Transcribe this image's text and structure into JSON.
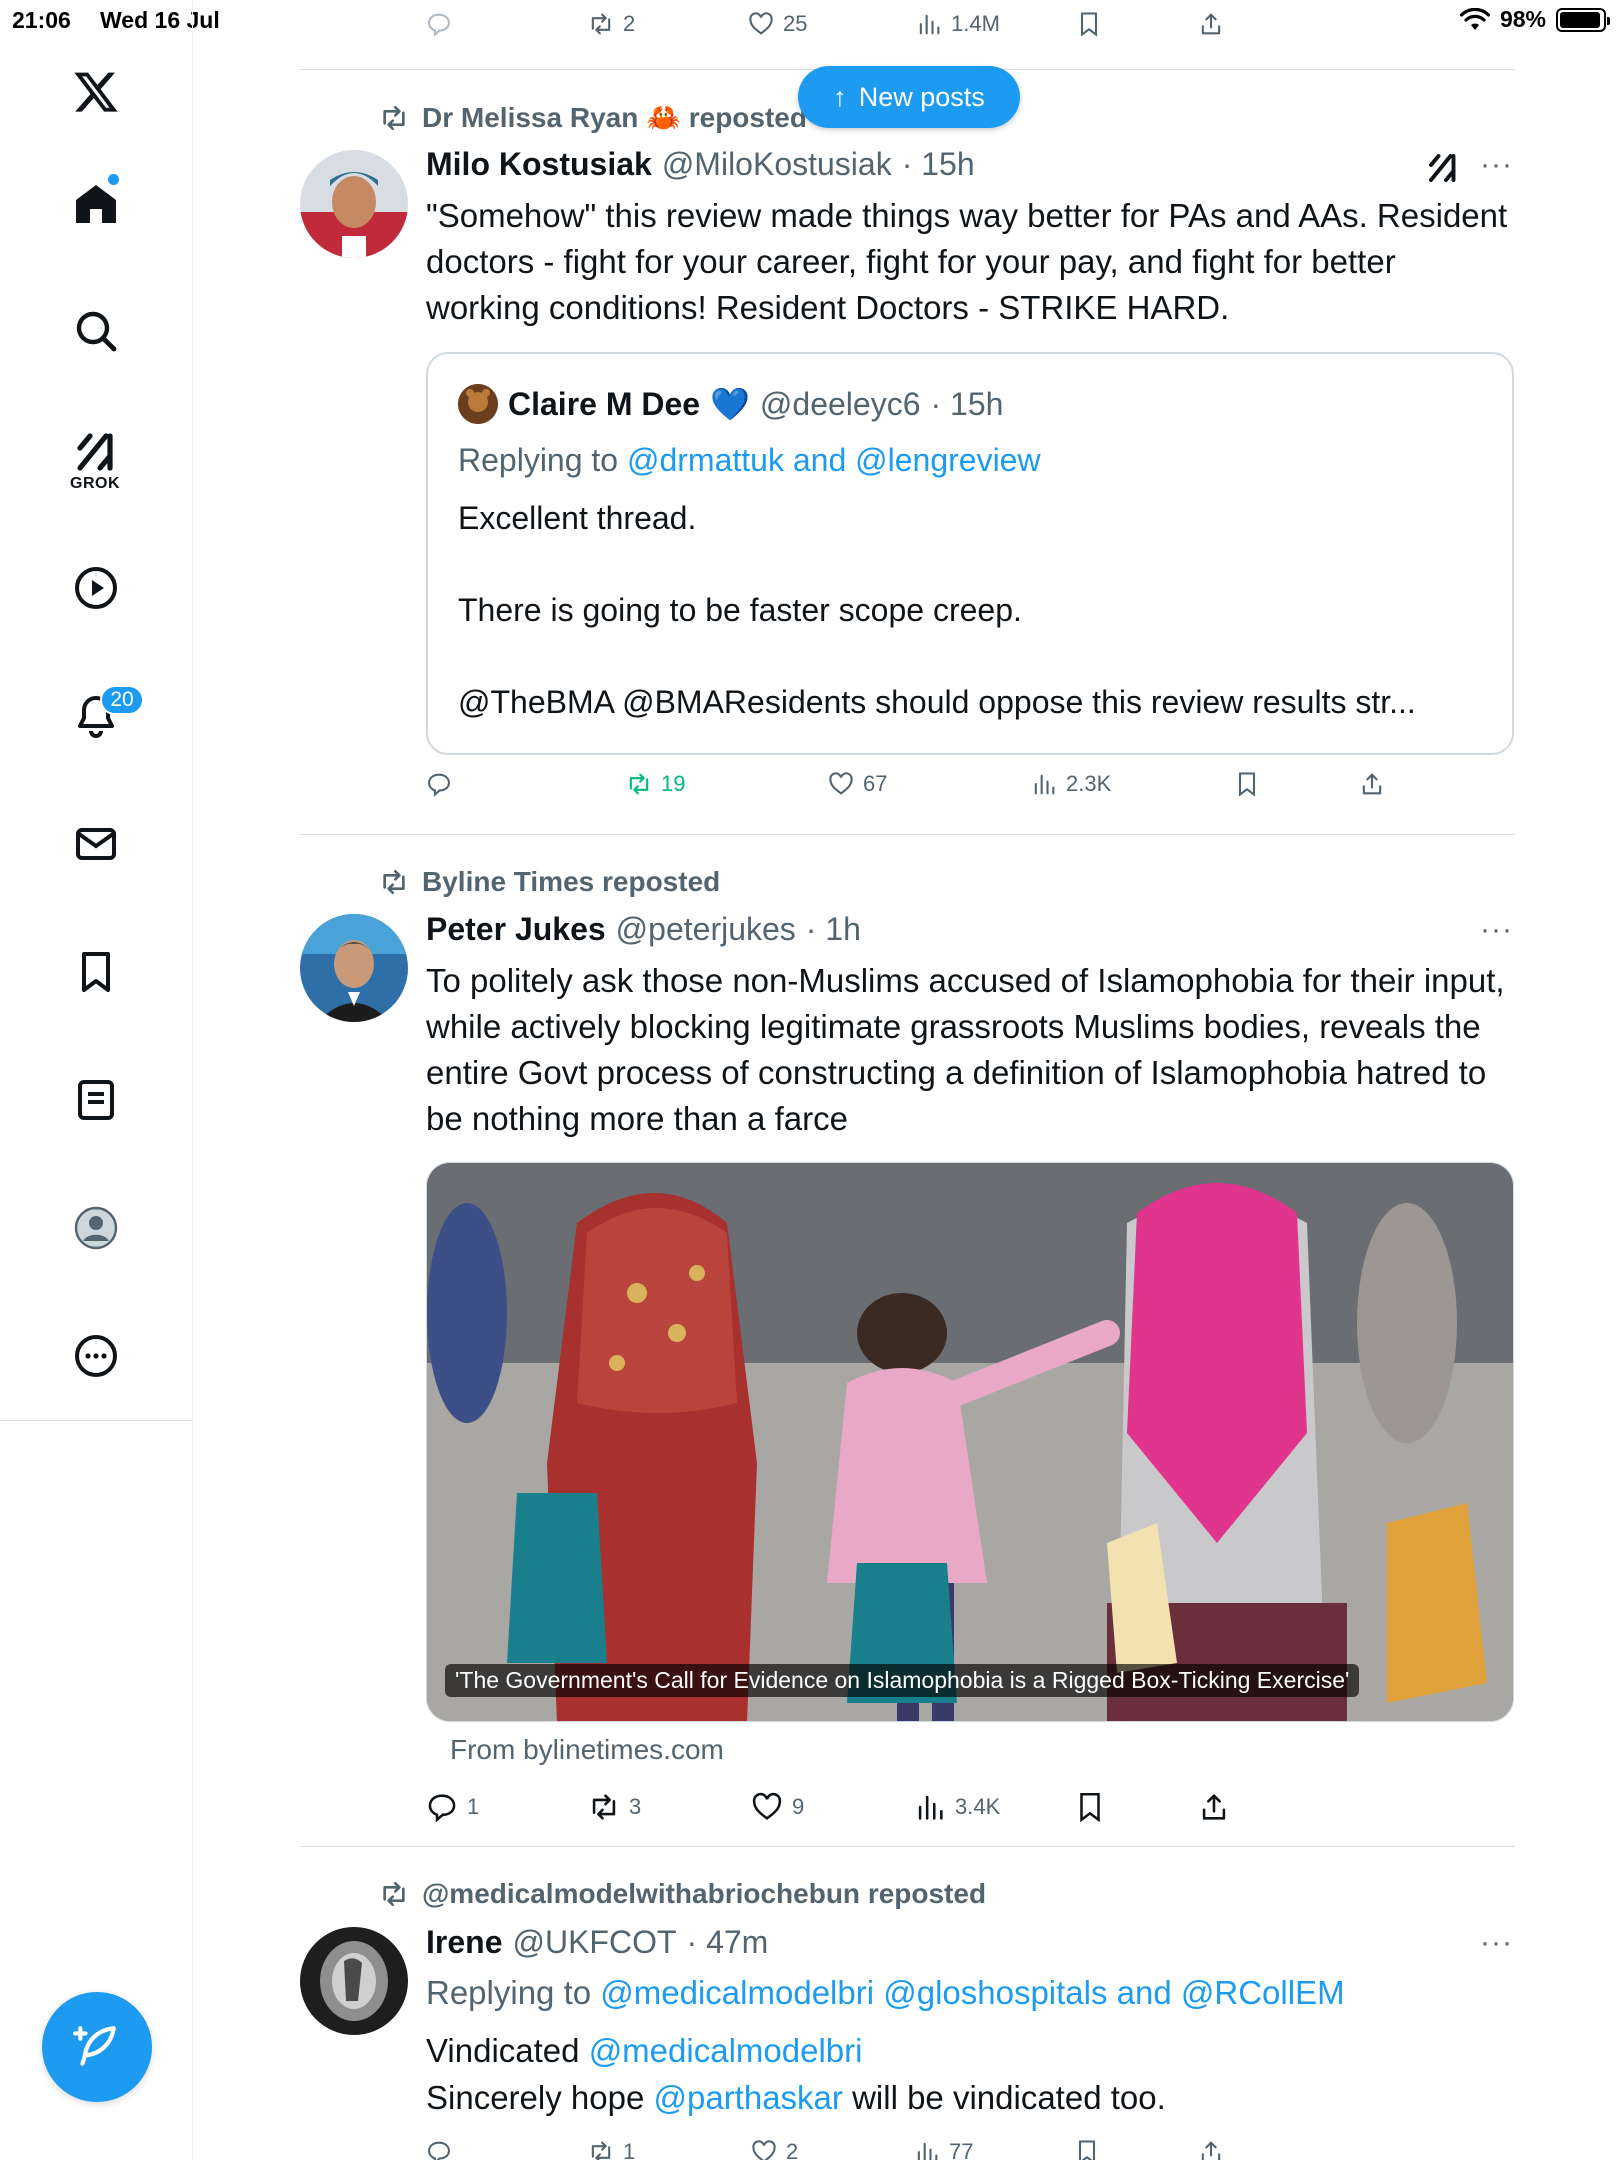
{
  "status_bar": {
    "time": "21:06",
    "date": "Wed 16 Jul",
    "battery": "98%"
  },
  "sidebar": {
    "grok_label": "GROK",
    "notifications_count": "20"
  },
  "new_posts": {
    "label": "New posts"
  },
  "top_actions": {
    "retweets": "2",
    "likes": "25",
    "views": "1.4M"
  },
  "tweets": [
    {
      "reposted_by": "Dr Melissa Ryan 🦀 reposted",
      "name": "Milo Kostusiak",
      "handle": "@MiloKostusiak",
      "time": "· 15h",
      "text": "\"Somehow\" this review made things way better for PAs and AAs. Resident doctors - fight for your career, fight for your pay, and fight for better working conditions! Resident Doctors - STRIKE HARD.",
      "quote": {
        "name": "Claire M Dee",
        "heart": "💙",
        "handle": "@deeleyc6",
        "time": "· 15h",
        "replying_label": "Replying to",
        "replying_to": "@drmattuk and @lengreview",
        "line1": "Excellent thread.",
        "line2": "There is going to be faster scope creep.",
        "line3": "@TheBMA @BMAResidents should oppose this review results str..."
      },
      "actions": {
        "replies": "",
        "retweets": "19",
        "likes": "67",
        "views": "2.3K"
      }
    },
    {
      "reposted_by": "Byline Times reposted",
      "name": "Peter Jukes",
      "handle": "@peterjukes",
      "time": "· 1h",
      "text": "To politely ask those non-Muslims accused of Islamophobia for their input, while actively blocking legitimate grassroots Muslims bodies, reveals the entire Govt process of constructing a definition of Islamophobia hatred to be nothing more than a farce",
      "media_caption": "'The Government's Call for Evidence on Islamophobia is a Rigged Box-Ticking Exercise'",
      "link_source": "From bylinetimes.com",
      "actions": {
        "replies": "1",
        "retweets": "3",
        "likes": "9",
        "views": "3.4K"
      }
    },
    {
      "reposted_by": "@medicalmodelwithabriochebun reposted",
      "name": "Irene",
      "handle": "@UKFCOT",
      "time": "· 47m",
      "replying_label": "Replying to",
      "replying_to": "@medicalmodelbri @gloshospitals and @RCollEM",
      "line1_prefix": "Vindicated",
      "line1_link": "@medicalmodelbri",
      "line2_prefix": "Sincerely hope",
      "line2_link": "@parthaskar",
      "line2_suffix": "will be vindicated too.",
      "actions": {
        "replies": "",
        "retweets": "1",
        "likes": "2",
        "views": "77"
      }
    }
  ],
  "colors": {
    "accent": "#1d9bf0",
    "muted": "#536471",
    "repost_green": "#00ba7c",
    "text": "#0f1419"
  },
  "icons": [
    "x-logo-icon",
    "home-icon",
    "search-icon",
    "grok-icon",
    "video-icon",
    "bell-icon",
    "mail-icon",
    "bookmark-icon",
    "lists-icon",
    "profile-icon",
    "more-icon",
    "compose-icon",
    "reply-icon",
    "retweet-icon",
    "like-icon",
    "views-icon",
    "share-icon",
    "wifi-icon",
    "battery-icon"
  ]
}
